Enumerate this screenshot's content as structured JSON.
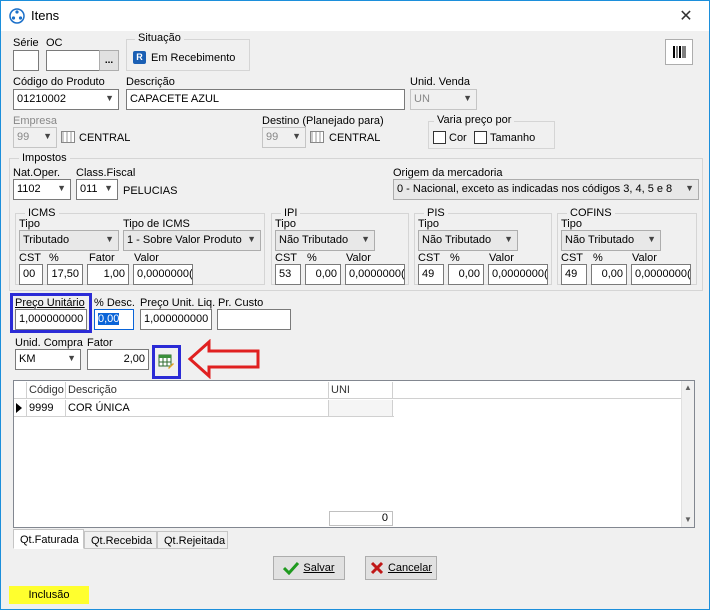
{
  "window": {
    "title": "Itens",
    "close_label": "✕"
  },
  "serie": {
    "label": "Série",
    "value": ""
  },
  "oc": {
    "label": "OC",
    "value": "",
    "button": "..."
  },
  "situacao": {
    "group_label": "Situação",
    "badge": "R",
    "value": "Em Recebimento"
  },
  "produto": {
    "label": "Código do Produto",
    "value": "01210002"
  },
  "descricao": {
    "label": "Descrição",
    "value": "CAPACETE AZUL"
  },
  "unid_venda": {
    "label": "Unid. Venda",
    "value": "UN"
  },
  "empresa": {
    "label": "Empresa",
    "value": "99",
    "name": "CENTRAL"
  },
  "destino": {
    "label": "Destino (Planejado para)",
    "value": "99",
    "name": "CENTRAL"
  },
  "varia_preco": {
    "label": "Varia preço por",
    "options": [
      {
        "label": "Cor"
      },
      {
        "label": "Tamanho"
      }
    ]
  },
  "impostos": {
    "group_label": "Impostos",
    "nat_oper": {
      "label": "Nat.Oper.",
      "value": "1102"
    },
    "class_fiscal": {
      "label": "Class.Fiscal",
      "value": "011",
      "name": "PELUCIAS"
    },
    "origem": {
      "label": "Origem da mercadoria",
      "value": "0 - Nacional, exceto as indicadas nos códigos 3, 4, 5 e 8"
    },
    "icms": {
      "group_label": "ICMS",
      "tipo_label": "Tipo",
      "tipo": "Tributado",
      "tipo_icms_label": "Tipo de ICMS",
      "tipo_icms": "1 - Sobre Valor Produto",
      "cst_label": "CST",
      "cst": "00",
      "perc_label": "%",
      "perc": "17,50",
      "fator_label": "Fator",
      "fator": "1,00",
      "valor_label": "Valor",
      "valor": "0,0000000("
    },
    "ipi": {
      "group_label": "IPI",
      "tipo_label": "Tipo",
      "tipo": "Não Tributado",
      "cst_label": "CST",
      "cst": "53",
      "perc_label": "%",
      "perc": "0,00",
      "valor_label": "Valor",
      "valor": "0,0000000("
    },
    "pis": {
      "group_label": "PIS",
      "tipo_label": "Tipo",
      "tipo": "Não Tributado",
      "cst_label": "CST",
      "cst": "49",
      "perc_label": "%",
      "perc": "0,00",
      "valor_label": "Valor",
      "valor": "0,0000000("
    },
    "cofins": {
      "group_label": "COFINS",
      "tipo_label": "Tipo",
      "tipo": "Não Tributado",
      "cst_label": "CST",
      "cst": "49",
      "perc_label": "%",
      "perc": "0,00",
      "valor_label": "Valor",
      "valor": "0,0000000("
    }
  },
  "preco": {
    "unitario_label": "Preço Unitário",
    "unitario": "1,000000000",
    "desc_label": "% Desc.",
    "desc": "0,00",
    "liq_label": "Preço Unit. Liq.",
    "liq": "1,000000000",
    "custo_label": "Pr. Custo",
    "custo": ""
  },
  "unid_compra": {
    "label": "Unid. Compra",
    "value": "KM"
  },
  "fator": {
    "label": "Fator",
    "value": "2,00"
  },
  "grid": {
    "headers": [
      "Código",
      "Descrição",
      "UNI"
    ],
    "rows": [
      {
        "codigo": "9999",
        "descricao": "COR ÚNICA",
        "uni": ""
      }
    ],
    "footer_total": "0"
  },
  "tabs": [
    "Qt.Faturada",
    "Qt.Recebida",
    "Qt.Rejeitada"
  ],
  "buttons": {
    "salvar": "Salvar",
    "cancelar": "Cancelar"
  },
  "status": {
    "mode": "Inclusão"
  },
  "colors": {
    "highlight_box": "#2b2bd6",
    "arrow": "#e02020",
    "status_bg": "#ffff2e",
    "selection": "#0a64d8"
  }
}
